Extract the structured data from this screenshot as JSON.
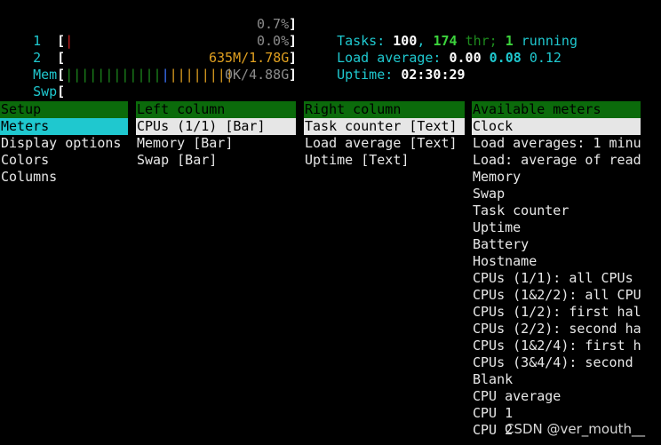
{
  "meters": {
    "cpu1": {
      "label": "1",
      "bar": "|",
      "value": "0.7%"
    },
    "cpu2": {
      "label": "2",
      "bar": "",
      "value": "0.0%"
    },
    "mem": {
      "label": "Mem",
      "bar_green": "||||||||||||",
      "bar_blue": "|",
      "bar_orange": "||||||||",
      "value": "635M/1.78G"
    },
    "swp": {
      "label": "Swp",
      "value": "0K/4.88G"
    },
    "tasks": {
      "label": "Tasks:",
      "count": "100",
      "threads": "174",
      "thr_label": "thr;",
      "running": "1",
      "running_label": "running"
    },
    "load": {
      "label": "Load average:",
      "l1": "0.00",
      "l5": "0.08",
      "l15": "0.12"
    },
    "uptime": {
      "label": "Uptime:",
      "value": "02:30:29"
    }
  },
  "setup": {
    "header": "Setup",
    "items": [
      "Meters",
      "Display options",
      "Colors",
      "Columns"
    ]
  },
  "left_column": {
    "header": "Left column",
    "items": [
      "CPUs (1/1) [Bar]",
      "Memory [Bar]",
      "Swap [Bar]"
    ]
  },
  "right_column": {
    "header": "Right column",
    "items": [
      "Task counter [Text]",
      "Load average [Text]",
      "Uptime [Text]"
    ]
  },
  "available_meters": {
    "header": "Available meters",
    "items": [
      "Clock",
      "Load averages: 1 minu",
      "Load: average of read",
      "Memory",
      "Swap",
      "Task counter",
      "Uptime",
      "Battery",
      "Hostname",
      "CPUs (1/1): all CPUs",
      "CPUs (1&2/2): all CPU",
      "CPUs (1/2): first hal",
      "CPUs (2/2): second ha",
      "CPUs (1&2/4): first h",
      "CPUs (3&4/4): second",
      "Blank",
      "CPU average",
      "CPU 1",
      "CPU 2"
    ]
  },
  "watermark": "CSDN @ver_mouth__",
  "colors": {
    "accent_cyan": "#1fc8cf",
    "header_green": "#0b6b0b",
    "selection_white": "#e6e6e6"
  }
}
